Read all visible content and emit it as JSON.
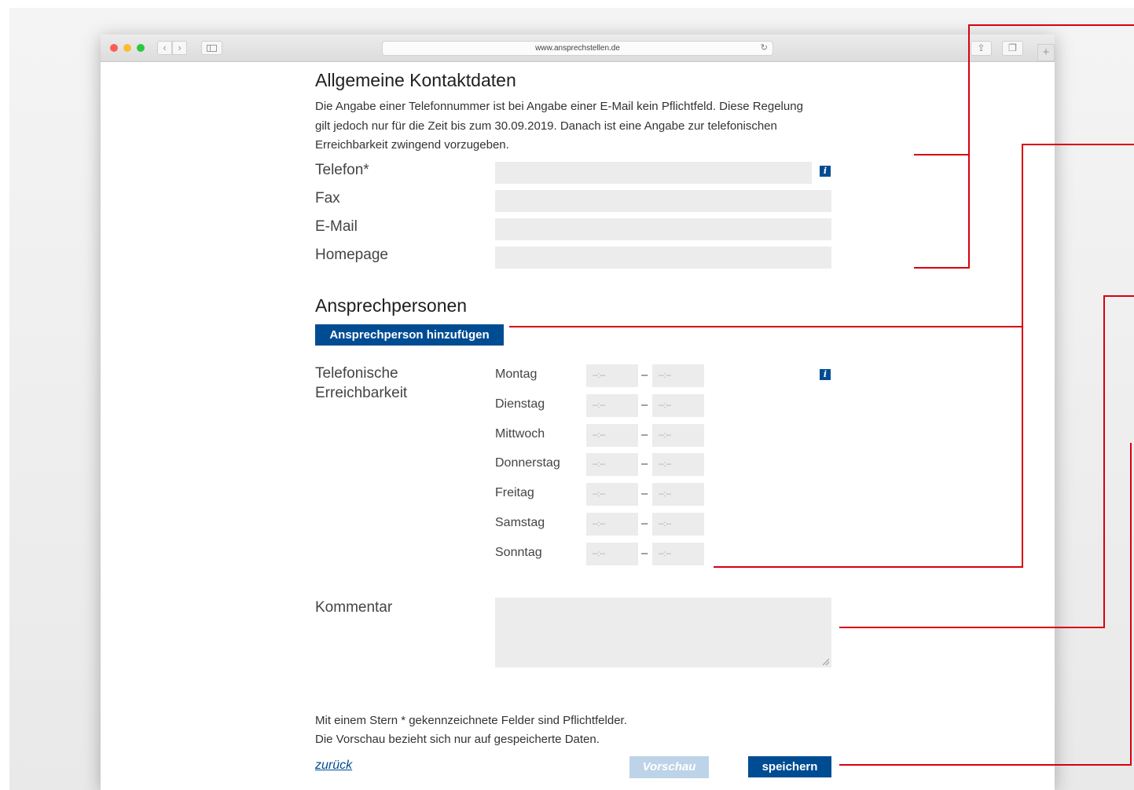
{
  "browser": {
    "url": "www.ansprechstellen.de"
  },
  "general_contact": {
    "title": "Allgemeine Kontaktdaten",
    "description": "Die Angabe einer Telefonnummer ist bei Angabe einer E-Mail kein Pflichtfeld. Diese Regelung gilt jedoch nur für die Zeit bis zum 30.09.2019. Danach ist eine Angabe zur telefonischen Erreichbarkeit zwingend vorzugeben.",
    "fields": [
      {
        "label": "Telefon*",
        "value": "",
        "has_info": true
      },
      {
        "label": "Fax",
        "value": ""
      },
      {
        "label": "E-Mail",
        "value": ""
      },
      {
        "label": "Homepage",
        "value": ""
      }
    ]
  },
  "contact_persons": {
    "title": "Ansprechpersonen",
    "add_button": "Ansprechperson hinzufügen"
  },
  "availability": {
    "label_line1": "Telefonische",
    "label_line2": "Erreichbarkeit",
    "time_placeholder": "--:--",
    "separator": "–",
    "days": [
      "Montag",
      "Dienstag",
      "Mittwoch",
      "Donnerstag",
      "Freitag",
      "Samstag",
      "Sonntag"
    ]
  },
  "comment": {
    "label": "Kommentar",
    "value": ""
  },
  "footer": {
    "required_note": "Mit einem Stern * gekennzeichnete Felder sind Pflichtfelder.",
    "preview_note": "Die Vorschau bezieht sich nur auf gespeicherte Daten.",
    "back_link": "zurück",
    "preview_button": "Vorschau",
    "save_button": "speichern"
  },
  "icons": {
    "info": "i"
  },
  "colors": {
    "accent_blue": "#004c93",
    "annotation_red": "#d8000f",
    "field_grey": "#ececec",
    "disabled_blue": "#bcd3e8"
  }
}
